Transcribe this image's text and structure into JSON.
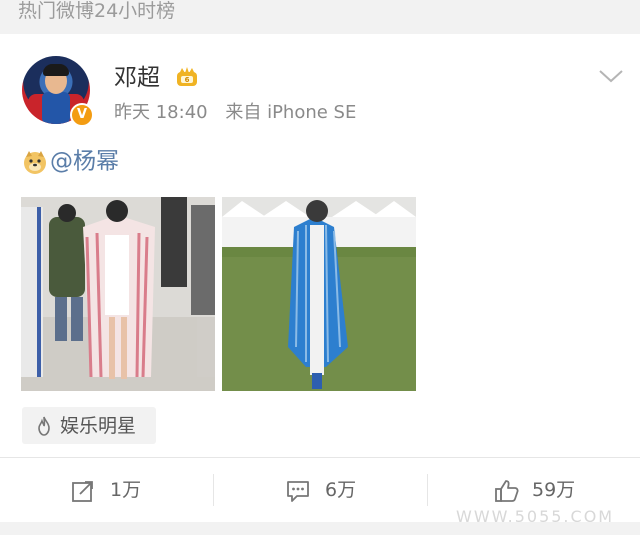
{
  "topbar": {
    "label": "热门微博24小时榜"
  },
  "post": {
    "author": "邓超",
    "time": "昨天 18:40",
    "source": "来自 iPhone SE",
    "mention": "@杨幂",
    "tag": "娱乐明星"
  },
  "actions": {
    "repost_count": "1万",
    "comment_count": "6万",
    "like_count": "59万"
  },
  "watermark": "WWW.5055.COM",
  "colors": {
    "mention": "#5a7da8",
    "vbadge": "#f39c12",
    "crown": "#f0b323"
  }
}
